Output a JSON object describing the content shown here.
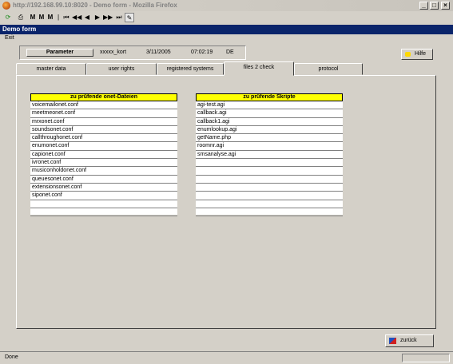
{
  "window": {
    "title": "http://192.168.99.10:8020 - Demo form - Mozilla Firefox",
    "minimize": "_",
    "maximize": "□",
    "close": "×"
  },
  "toolbar": {
    "buttons": [
      "reload-icon",
      "print-icon",
      "find-icon",
      "find-next-icon",
      "find-all-icon",
      "first-icon",
      "rewind-icon",
      "prev-icon",
      "next-icon",
      "fast-forward-icon",
      "last-icon",
      "edit-icon"
    ]
  },
  "app": {
    "title": "Demo form",
    "menu_exit": "Exit"
  },
  "header": {
    "parameter_label": "Parameter",
    "user": "xxxxx_kort",
    "date": "3/11/2005",
    "time": "07:02:19",
    "lang": "DE"
  },
  "hilfe_label": "Hilfe",
  "tabs": [
    {
      "label": "master data"
    },
    {
      "label": "user rights"
    },
    {
      "label": "registered systems"
    },
    {
      "label": "files 2 check"
    },
    {
      "label": "protocol"
    }
  ],
  "active_tab": "files 2 check",
  "list_left": {
    "header": "zu prüfende onet-Dateien",
    "items": [
      "voicemailonet.conf",
      "meetmeonet.conf",
      "mrxonet.conf",
      "soundsonet.conf",
      "callthroughonet.conf",
      "enumonet.conf",
      "capionet.conf",
      "ivronet.conf",
      "musiconholdonet.conf",
      "queuesonet.conf",
      "extensionsonet.conf",
      "siponet.conf",
      "",
      ""
    ]
  },
  "list_right": {
    "header": "zu prüfende Skripte",
    "items": [
      "agi-test.agi",
      "callback.agi",
      "callback1.agi",
      "enumlookup.agi",
      "getName.php",
      "roomnr.agi",
      "smsanalyse.agi",
      "",
      "",
      "",
      "",
      "",
      "",
      ""
    ]
  },
  "zurueck_label": "zurück",
  "status": "Done",
  "colors": {
    "header_bar": "#0a246a",
    "list_header": "#ffff00",
    "window_bg": "#d4d0c8"
  }
}
